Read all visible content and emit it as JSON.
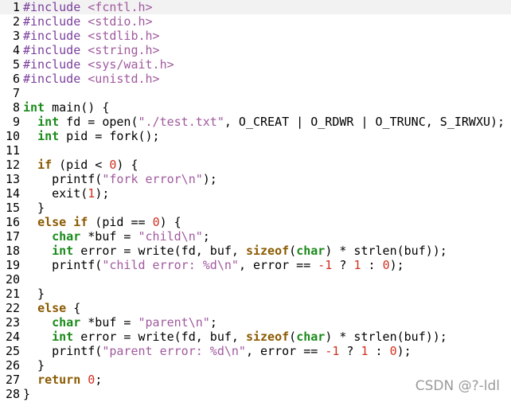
{
  "colors": {
    "background": "#ffffff",
    "current_line": "#f2f2f2",
    "preproc": "#7a3e9d",
    "string": "#a05a9e",
    "keyword": "#8a5a00",
    "type": "#1a8a1a",
    "number": "#d0301f"
  },
  "editor": {
    "lines": [
      {
        "n": "1",
        "tokens": [
          [
            "comment",
            "#include "
          ],
          [
            "string",
            "<fcntl.h>"
          ]
        ]
      },
      {
        "n": "2",
        "tokens": [
          [
            "comment",
            "#include "
          ],
          [
            "string",
            "<stdio.h>"
          ]
        ]
      },
      {
        "n": "3",
        "tokens": [
          [
            "comment",
            "#include "
          ],
          [
            "string",
            "<stdlib.h>"
          ]
        ]
      },
      {
        "n": "4",
        "tokens": [
          [
            "comment",
            "#include "
          ],
          [
            "string",
            "<string.h>"
          ]
        ]
      },
      {
        "n": "5",
        "tokens": [
          [
            "comment",
            "#include "
          ],
          [
            "string",
            "<sys/wait.h>"
          ]
        ]
      },
      {
        "n": "6",
        "tokens": [
          [
            "comment",
            "#include "
          ],
          [
            "string",
            "<unistd.h>"
          ]
        ]
      },
      {
        "n": "7",
        "tokens": []
      },
      {
        "n": "8",
        "tokens": [
          [
            "type",
            "int"
          ],
          [
            "plain",
            " main() {"
          ]
        ]
      },
      {
        "n": "9",
        "tokens": [
          [
            "plain",
            "  "
          ],
          [
            "type",
            "int"
          ],
          [
            "plain",
            " fd = open("
          ],
          [
            "string",
            "\"./test.txt\""
          ],
          [
            "plain",
            ", O_CREAT | O_RDWR | O_TRUNC, S_IRWXU);"
          ]
        ]
      },
      {
        "n": "10",
        "tokens": [
          [
            "plain",
            "  "
          ],
          [
            "type",
            "int"
          ],
          [
            "plain",
            " pid = fork();"
          ]
        ]
      },
      {
        "n": "11",
        "tokens": []
      },
      {
        "n": "12",
        "tokens": [
          [
            "plain",
            "  "
          ],
          [
            "keyword",
            "if"
          ],
          [
            "plain",
            " (pid < "
          ],
          [
            "number",
            "0"
          ],
          [
            "plain",
            ") {"
          ]
        ]
      },
      {
        "n": "13",
        "tokens": [
          [
            "plain",
            "    printf("
          ],
          [
            "string",
            "\"fork error\\n\""
          ],
          [
            "plain",
            ");"
          ]
        ]
      },
      {
        "n": "14",
        "tokens": [
          [
            "plain",
            "    exit("
          ],
          [
            "number",
            "1"
          ],
          [
            "plain",
            ");"
          ]
        ]
      },
      {
        "n": "15",
        "tokens": [
          [
            "plain",
            "  }"
          ]
        ]
      },
      {
        "n": "16",
        "tokens": [
          [
            "plain",
            "  "
          ],
          [
            "keyword",
            "else if"
          ],
          [
            "plain",
            " (pid == "
          ],
          [
            "number",
            "0"
          ],
          [
            "plain",
            ") {"
          ]
        ]
      },
      {
        "n": "17",
        "tokens": [
          [
            "plain",
            "    "
          ],
          [
            "type",
            "char"
          ],
          [
            "plain",
            " *buf = "
          ],
          [
            "string",
            "\"child\\n\""
          ],
          [
            "plain",
            ";"
          ]
        ]
      },
      {
        "n": "18",
        "tokens": [
          [
            "plain",
            "    "
          ],
          [
            "type",
            "int"
          ],
          [
            "plain",
            " error = write(fd, buf, "
          ],
          [
            "keyword",
            "sizeof"
          ],
          [
            "plain",
            "("
          ],
          [
            "type",
            "char"
          ],
          [
            "plain",
            ") * strlen(buf));"
          ]
        ]
      },
      {
        "n": "19",
        "tokens": [
          [
            "plain",
            "    printf("
          ],
          [
            "string",
            "\"child error: %d\\n\""
          ],
          [
            "plain",
            ", error == "
          ],
          [
            "number",
            "-1"
          ],
          [
            "plain",
            " ? "
          ],
          [
            "number",
            "1"
          ],
          [
            "plain",
            " : "
          ],
          [
            "number",
            "0"
          ],
          [
            "plain",
            ");"
          ]
        ]
      },
      {
        "n": "20",
        "tokens": []
      },
      {
        "n": "21",
        "tokens": [
          [
            "plain",
            "  }"
          ]
        ]
      },
      {
        "n": "22",
        "tokens": [
          [
            "plain",
            "  "
          ],
          [
            "keyword",
            "else"
          ],
          [
            "plain",
            " {"
          ]
        ]
      },
      {
        "n": "23",
        "tokens": [
          [
            "plain",
            "    "
          ],
          [
            "type",
            "char"
          ],
          [
            "plain",
            " *buf = "
          ],
          [
            "string",
            "\"parent\\n\""
          ],
          [
            "plain",
            ";"
          ]
        ]
      },
      {
        "n": "24",
        "tokens": [
          [
            "plain",
            "    "
          ],
          [
            "type",
            "int"
          ],
          [
            "plain",
            " error = write(fd, buf, "
          ],
          [
            "keyword",
            "sizeof"
          ],
          [
            "plain",
            "("
          ],
          [
            "type",
            "char"
          ],
          [
            "plain",
            ") * strlen(buf));"
          ]
        ]
      },
      {
        "n": "25",
        "tokens": [
          [
            "plain",
            "    printf("
          ],
          [
            "string",
            "\"parent error: %d\\n\""
          ],
          [
            "plain",
            ", error == "
          ],
          [
            "number",
            "-1"
          ],
          [
            "plain",
            " ? "
          ],
          [
            "number",
            "1"
          ],
          [
            "plain",
            " : "
          ],
          [
            "number",
            "0"
          ],
          [
            "plain",
            ");"
          ]
        ]
      },
      {
        "n": "26",
        "tokens": [
          [
            "plain",
            "  }"
          ]
        ]
      },
      {
        "n": "27",
        "tokens": [
          [
            "plain",
            "  "
          ],
          [
            "keyword",
            "return"
          ],
          [
            "plain",
            " "
          ],
          [
            "number",
            "0"
          ],
          [
            "plain",
            ";"
          ]
        ]
      },
      {
        "n": "28",
        "tokens": [
          [
            "plain",
            "}"
          ]
        ]
      }
    ]
  },
  "watermark": "CSDN @?-ldl"
}
